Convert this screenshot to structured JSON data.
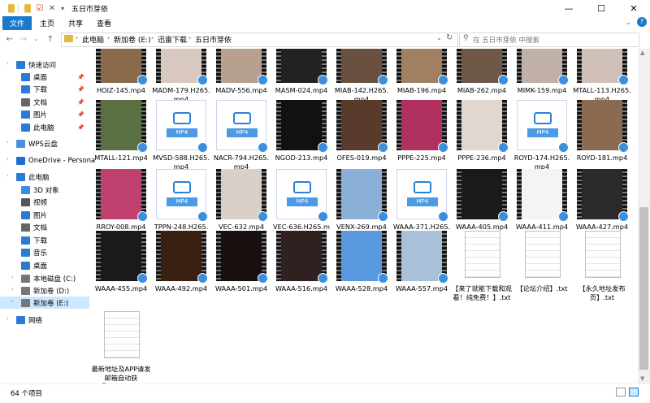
{
  "window": {
    "title": "五日市芽依"
  },
  "ribbon": {
    "tabs": [
      "文件",
      "主页",
      "共享",
      "查看"
    ]
  },
  "address": {
    "crumbs": [
      "此电脑",
      "新加卷 (E:)",
      "迅雷下载",
      "五日市芽依"
    ]
  },
  "search": {
    "placeholder": "在 五日市芽依 中搜索"
  },
  "sidebar": {
    "items": [
      {
        "label": "快速访问",
        "icon": "star-icon",
        "color": "#2a7bd6"
      },
      {
        "label": "桌面",
        "icon": "desktop-icon",
        "color": "#2a7bd6",
        "pinned": true
      },
      {
        "label": "下载",
        "icon": "download-icon",
        "color": "#2a7bd6",
        "pinned": true
      },
      {
        "label": "文档",
        "icon": "document-icon",
        "color": "#666666",
        "pinned": true
      },
      {
        "label": "图片",
        "icon": "pictures-icon",
        "color": "#2a7bd6",
        "pinned": true
      },
      {
        "label": "此电脑",
        "icon": "computer-icon",
        "color": "#2a7bd6",
        "pinned": true
      },
      {
        "label": "WPS云盘",
        "icon": "cloud-icon",
        "color": "#4a90e2"
      },
      {
        "label": "OneDrive - Persona",
        "icon": "onedrive-icon",
        "color": "#1e6fd0"
      },
      {
        "label": "此电脑",
        "icon": "computer-icon",
        "color": "#2a7bd6"
      },
      {
        "label": "3D 对象",
        "icon": "cube-icon",
        "color": "#3a8ee0"
      },
      {
        "label": "视频",
        "icon": "video-icon",
        "color": "#555555"
      },
      {
        "label": "图片",
        "icon": "pictures-icon",
        "color": "#2a7bd6"
      },
      {
        "label": "文档",
        "icon": "document-icon",
        "color": "#666666"
      },
      {
        "label": "下载",
        "icon": "download-icon",
        "color": "#2a7bd6"
      },
      {
        "label": "音乐",
        "icon": "music-icon",
        "color": "#2a7bd6"
      },
      {
        "label": "桌面",
        "icon": "desktop-icon",
        "color": "#2a7bd6"
      },
      {
        "label": "本地磁盘 (C:)",
        "icon": "drive-icon",
        "color": "#777777"
      },
      {
        "label": "新加卷 (D:)",
        "icon": "drive-icon",
        "color": "#777777"
      },
      {
        "label": "新加卷 (E:)",
        "icon": "drive-icon",
        "color": "#777777",
        "selected": true
      },
      {
        "label": "网络",
        "icon": "network-icon",
        "color": "#2a7bd6"
      }
    ]
  },
  "files": [
    {
      "name": "HOIZ-145.mp4",
      "kind": "video",
      "tone": "#8a6a4a"
    },
    {
      "name": "MADM-179.H265.mp4",
      "kind": "video",
      "tone": "#d8c8c0"
    },
    {
      "name": "MADV-556.mp4",
      "kind": "video",
      "tone": "#b8a090"
    },
    {
      "name": "MASM-024.mp4",
      "kind": "video",
      "tone": "#222222"
    },
    {
      "name": "MIAB-142.H265.mp4",
      "kind": "video",
      "tone": "#6a5040"
    },
    {
      "name": "MIAB-196.mp4",
      "kind": "video",
      "tone": "#a08060"
    },
    {
      "name": "MIAB-262.mp4",
      "kind": "video",
      "tone": "#705848"
    },
    {
      "name": "MIMK-159.mp4",
      "kind": "video",
      "tone": "#c0b0a8"
    },
    {
      "name": "MTALL-113.H265.mp4",
      "kind": "video",
      "tone": "#d0c0b8"
    },
    {
      "name": "MTALL-121.mp4",
      "kind": "video",
      "tone": "#5a7040"
    },
    {
      "name": "MVSD-588.H265.mp4",
      "kind": "mp4",
      "tone": ""
    },
    {
      "name": "NACR-794.H265.mp4",
      "kind": "mp4",
      "tone": ""
    },
    {
      "name": "NGOD-213.mp4",
      "kind": "video",
      "tone": "#111111"
    },
    {
      "name": "OFES-019.mp4",
      "kind": "video",
      "tone": "#5a3a2a"
    },
    {
      "name": "PPPE-225.mp4",
      "kind": "video",
      "tone": "#b03060"
    },
    {
      "name": "PPPE-236.mp4",
      "kind": "video",
      "tone": "#e0d8d0"
    },
    {
      "name": "ROYD-174.H265.mp4",
      "kind": "mp4",
      "tone": ""
    },
    {
      "name": "ROYD-181.mp4",
      "kind": "video",
      "tone": "#8a6a50"
    },
    {
      "name": "RROY-008.mp4",
      "kind": "video",
      "tone": "#c04070"
    },
    {
      "name": "TPPN-248.H265.mp4",
      "kind": "mp4",
      "tone": ""
    },
    {
      "name": "VEC-632.mp4",
      "kind": "video",
      "tone": "#d8d0c8"
    },
    {
      "name": "VEC-636.H265.mp4",
      "kind": "mp4",
      "tone": ""
    },
    {
      "name": "VENX-269.mp4",
      "kind": "video",
      "tone": "#8ab0d8"
    },
    {
      "name": "WAAA-371.H265.mp4",
      "kind": "mp4",
      "tone": ""
    },
    {
      "name": "WAAA-405.mp4",
      "kind": "video",
      "tone": "#1a1a1a"
    },
    {
      "name": "WAAA-411.mp4",
      "kind": "video",
      "tone": "#f4f4f4"
    },
    {
      "name": "WAAA-427.mp4",
      "kind": "video",
      "tone": "#2a2a2a"
    },
    {
      "name": "WAAA-455.mp4",
      "kind": "video",
      "tone": "#1a1a1a"
    },
    {
      "name": "WAAA-492.mp4",
      "kind": "video",
      "tone": "#3a2010"
    },
    {
      "name": "WAAA-501.mp4",
      "kind": "video",
      "tone": "#1a1010"
    },
    {
      "name": "WAAA-516.mp4",
      "kind": "video",
      "tone": "#302020"
    },
    {
      "name": "WAAA-528.mp4",
      "kind": "video",
      "tone": "#5a98e0"
    },
    {
      "name": "WAAA-557.mp4",
      "kind": "video",
      "tone": "#a8c0d8"
    },
    {
      "name": "【来了就能下载和观看！纯免费！】.txt",
      "kind": "txt",
      "tone": ""
    },
    {
      "name": "【论坛介绍】.txt",
      "kind": "txt",
      "tone": ""
    },
    {
      "name": "【永久地址发布页】.txt",
      "kind": "txt",
      "tone": ""
    },
    {
      "name": "最新地址及APP请发邮箱自动获取！！！.txt",
      "kind": "txt",
      "tone": ""
    }
  ],
  "status": {
    "count": "64 个项目"
  },
  "colors": {
    "accent": "#1979ca",
    "selection": "#cce8ff"
  }
}
